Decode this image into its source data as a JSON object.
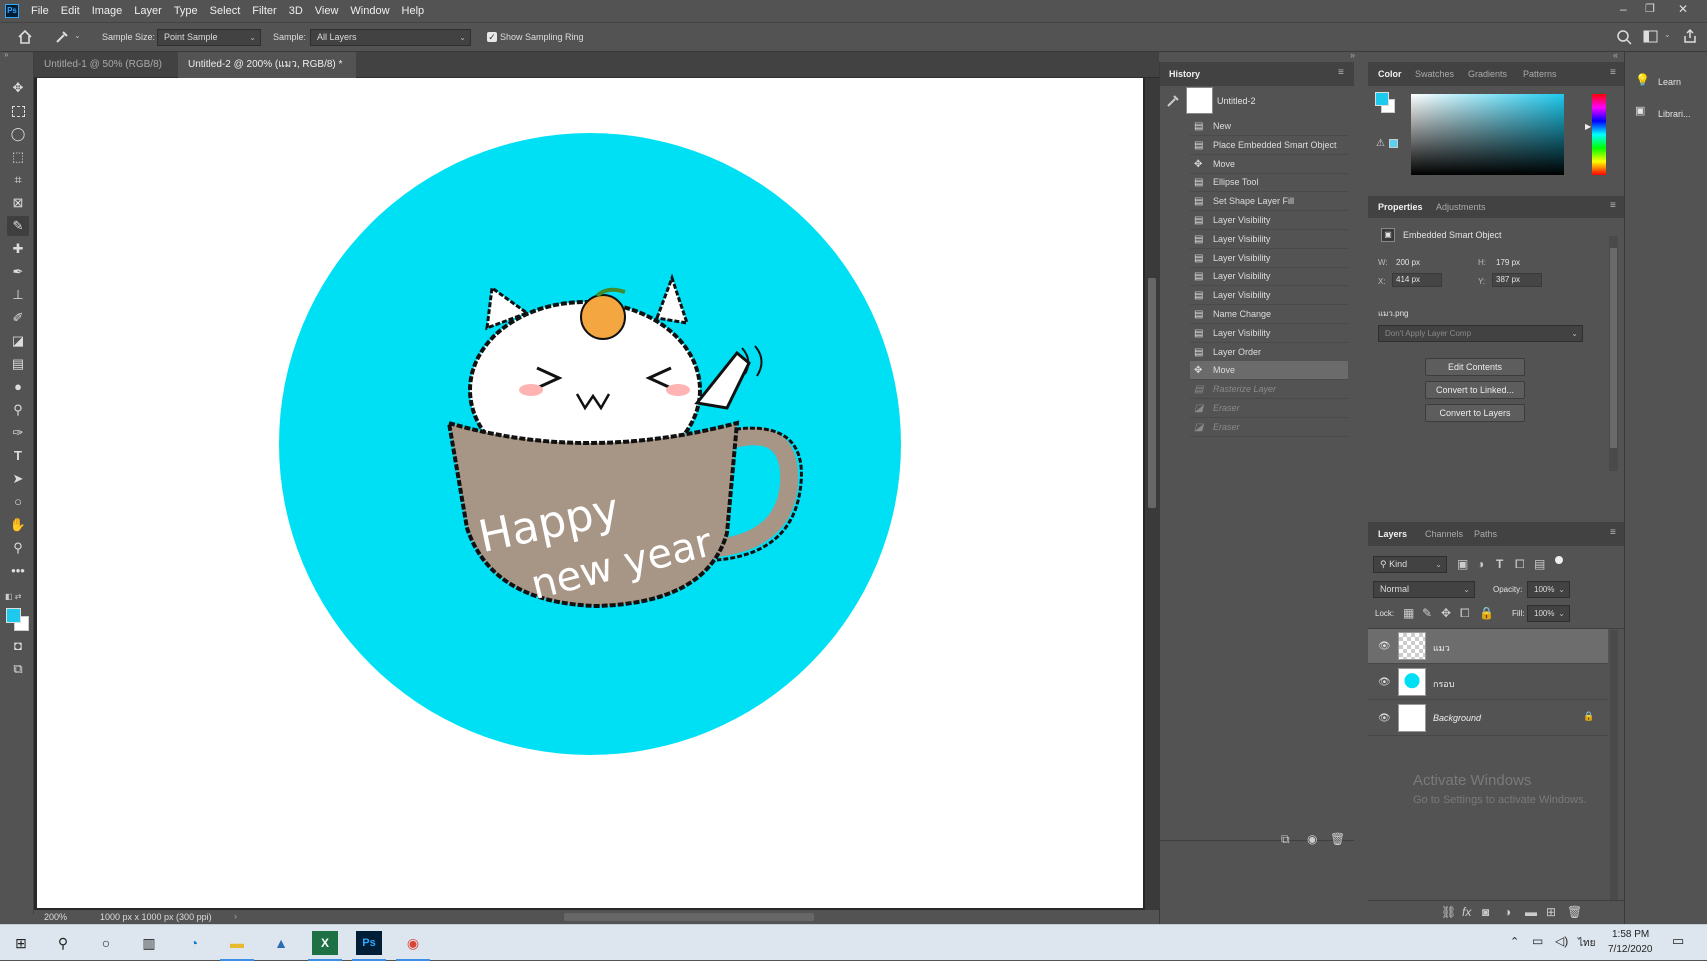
{
  "app": {
    "logo": "Ps"
  },
  "menubar": {
    "items": [
      "File",
      "Edit",
      "Image",
      "Layer",
      "Type",
      "Select",
      "Filter",
      "3D",
      "View",
      "Window",
      "Help"
    ]
  },
  "window_controls": {
    "minimize": "–",
    "restore": "❐",
    "close": "✕"
  },
  "options_bar": {
    "sample_size_label": "Sample Size:",
    "sample_size_value": "Point Sample",
    "sample_label": "Sample:",
    "sample_value": "All Layers",
    "show_sampling_ring": "Show Sampling Ring",
    "show_sampling_ring_checked": true
  },
  "doc_tabs": [
    {
      "label": "Untitled-1 @ 50% (RGB/8)",
      "close": "×"
    },
    {
      "label": "Untitled-2 @ 200% (แมว, RGB/8) *",
      "close": "×"
    }
  ],
  "canvas": {
    "circle_color": "#00e0f5",
    "artwork_text_line1": "Happy",
    "artwork_text_line2": "new year"
  },
  "status": {
    "zoom": "200%",
    "doc_info": "1000 px x 1000 px (300 ppi)"
  },
  "history": {
    "tab": "History",
    "snapshot_name": "Untitled-2",
    "items": [
      {
        "label": "New",
        "icon": "document-icon"
      },
      {
        "label": "Place Embedded Smart Object",
        "icon": "document-icon"
      },
      {
        "label": "Move",
        "icon": "move-icon"
      },
      {
        "label": "Ellipse Tool",
        "icon": "document-icon"
      },
      {
        "label": "Set Shape Layer Fill",
        "icon": "document-icon"
      },
      {
        "label": "Layer Visibility",
        "icon": "document-icon"
      },
      {
        "label": "Layer Visibility",
        "icon": "document-icon"
      },
      {
        "label": "Layer Visibility",
        "icon": "document-icon"
      },
      {
        "label": "Layer Visibility",
        "icon": "document-icon"
      },
      {
        "label": "Layer Visibility",
        "icon": "document-icon"
      },
      {
        "label": "Name Change",
        "icon": "document-icon"
      },
      {
        "label": "Layer Visibility",
        "icon": "document-icon"
      },
      {
        "label": "Layer Order",
        "icon": "document-icon"
      },
      {
        "label": "Move",
        "icon": "move-icon"
      },
      {
        "label": "Rasterize Layer",
        "icon": "document-icon"
      },
      {
        "label": "Eraser",
        "icon": "eraser-icon"
      },
      {
        "label": "Eraser",
        "icon": "eraser-icon"
      }
    ]
  },
  "color_panel": {
    "tabs": [
      "Color",
      "Swatches",
      "Gradients",
      "Patterns"
    ],
    "foreground": "#1ec9ee",
    "background": "#ffffff"
  },
  "properties": {
    "tabs": [
      "Properties",
      "Adjustments"
    ],
    "type": "Embedded Smart Object",
    "w_label": "W:",
    "w": "200 px",
    "h_label": "H:",
    "h": "179 px",
    "x_label": "X:",
    "x": "414 px",
    "y_label": "Y:",
    "y": "387 px",
    "filename": "แมว.png",
    "layer_comp": "Don't Apply Layer Comp",
    "buttons": [
      "Edit Contents",
      "Convert to Linked...",
      "Convert to Layers"
    ]
  },
  "layers": {
    "tabs": [
      "Layers",
      "Channels",
      "Paths"
    ],
    "filter": "Kind",
    "blend_mode": "Normal",
    "opacity_label": "Opacity:",
    "opacity": "100%",
    "lock_label": "Lock:",
    "fill_label": "Fill:",
    "fill": "100%",
    "items": [
      {
        "name": "แมว",
        "selected": true
      },
      {
        "name": "กรอบ",
        "selected": false
      },
      {
        "name": "Background",
        "selected": false,
        "locked": true
      }
    ]
  },
  "right_strip": {
    "learn": "Learn",
    "libraries": "Librari..."
  },
  "watermark": {
    "line1": "Activate Windows",
    "line2": "Go to Settings to activate Windows."
  },
  "taskbar": {
    "time": "1:58 PM",
    "date": "7/12/2020",
    "lang": "ไทย"
  }
}
